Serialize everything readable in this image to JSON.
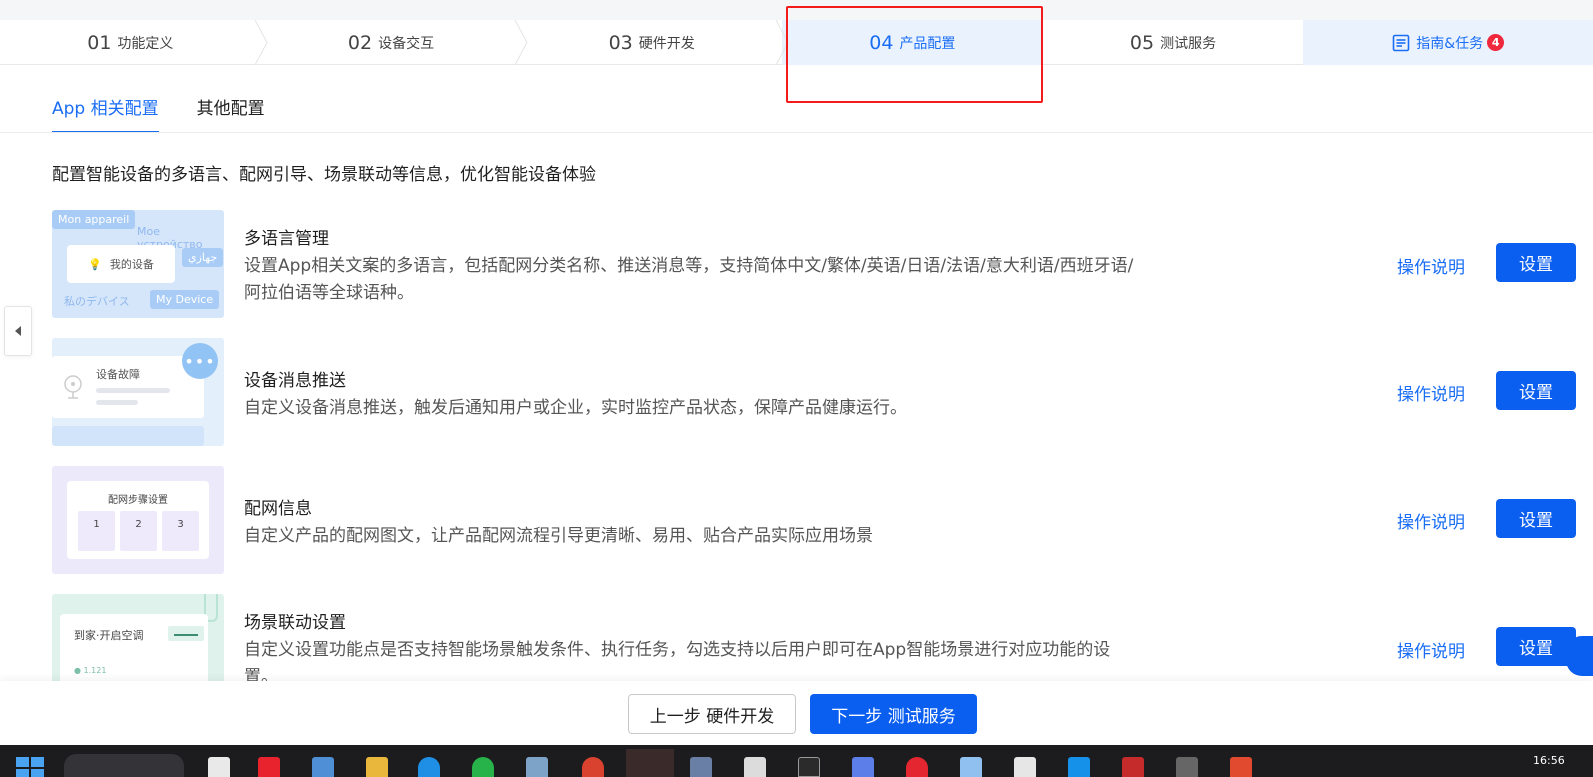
{
  "steps": [
    {
      "num": "01",
      "label": "功能定义"
    },
    {
      "num": "02",
      "label": "设备交互"
    },
    {
      "num": "03",
      "label": "硬件开发"
    },
    {
      "num": "04",
      "label": "产品配置"
    },
    {
      "num": "05",
      "label": "测试服务"
    }
  ],
  "guide": {
    "label": "指南&任务",
    "badge": "4",
    "icon": "document-list-icon"
  },
  "tabs": [
    {
      "label": "App 相关配置"
    },
    {
      "label": "其他配置"
    }
  ],
  "description": "配置智能设备的多语言、配网引导、场景联动等信息，优化智能设备体验",
  "rows": [
    {
      "title": "多语言管理",
      "text": "设置App相关文案的多语言，包括配网分类名称、推送消息等，支持简体中文/繁体/英语/日语/法语/意大利语/西班牙语/阿拉伯语等全球语种。",
      "help": "操作说明",
      "button": "设置",
      "thumb": {
        "tag1": "Mon appareil",
        "tag2": "Мое устройство",
        "tag3": "جهازي",
        "card": "我的设备",
        "tag4": "私のデバイス",
        "tag5": "My Device"
      }
    },
    {
      "title": "设备消息推送",
      "text": "自定义设备消息推送，触发后通知用户或企业，实时监控产品状态，保障产品健康运行。",
      "help": "操作说明",
      "button": "设置",
      "thumb": {
        "card": "设备故障",
        "bubble": "•••"
      }
    },
    {
      "title": "配网信息",
      "text": "自定义产品的配网图文，让产品配网流程引导更清晰、易用、贴合产品实际应用场景",
      "help": "操作说明",
      "button": "设置",
      "thumb": {
        "card": "配网步骤设置",
        "steps": [
          "1",
          "2",
          "3"
        ]
      }
    },
    {
      "title": "场景联动设置",
      "text": "自定义设置功能点是否支持智能场景触发条件、执行任务，勾选支持以后用户即可在App智能场景进行对应功能的设置。",
      "help": "操作说明",
      "button": "设置",
      "thumb": {
        "card": "到家·开启空调",
        "small": "● 1.121"
      }
    }
  ],
  "footer": {
    "prev": "上一步 硬件开发",
    "next": "下一步 测试服务"
  },
  "taskbar": {
    "clock": "16:56"
  },
  "colors": {
    "accent": "#1a6ef5",
    "button": "#0a5ff0",
    "highlight": "#f41b1b",
    "badge": "#f0283c"
  }
}
